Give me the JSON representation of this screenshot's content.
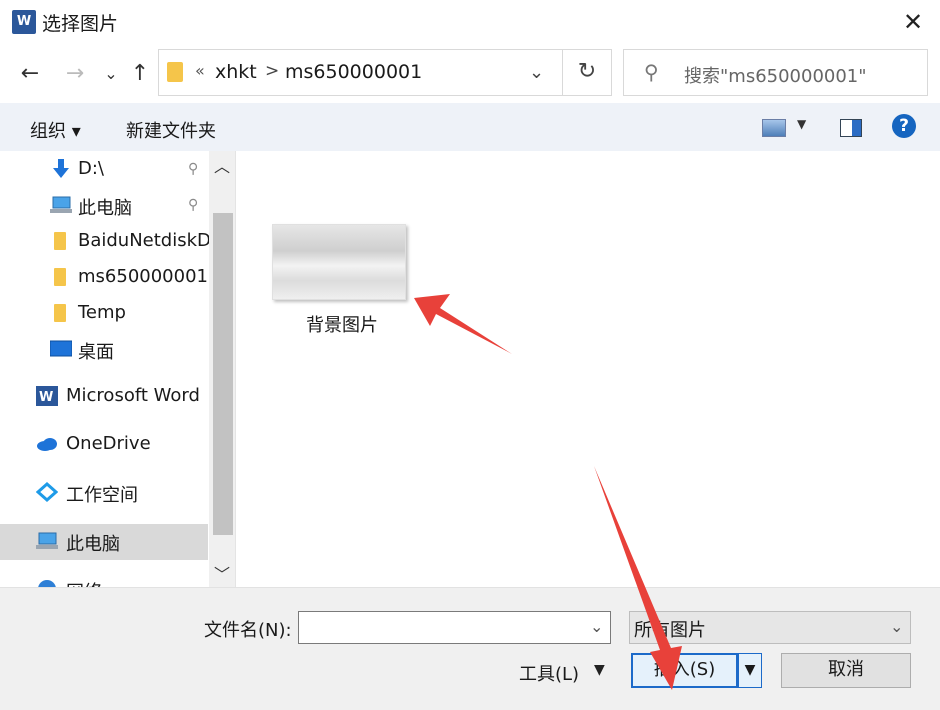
{
  "window": {
    "title": "选择图片",
    "close_glyph": "✕",
    "app_icon_letter": "W"
  },
  "nav": {
    "back": "←",
    "forward": "→",
    "recent": "⌄",
    "up": "↑"
  },
  "address": {
    "overflow": "«",
    "crumbs": [
      "xhkt",
      "ms650000001"
    ],
    "separator": ">",
    "dropdown": "⌄",
    "refresh": "↻"
  },
  "search": {
    "placeholder": "搜索\"ms650000001\"",
    "icon": "⚲"
  },
  "toolbar": {
    "organize": "组织 ▾",
    "new_folder": "新建文件夹",
    "view_dd": "▼",
    "help": "?"
  },
  "navpane": {
    "items": [
      {
        "label": "D:\\",
        "icon": "download-arrow-icon",
        "pinned": true
      },
      {
        "label": "此电脑",
        "icon": "computer-icon",
        "pinned": true
      },
      {
        "label": "BaiduNetdiskD",
        "icon": "folder-icon",
        "pinned": false
      },
      {
        "label": "ms650000001",
        "icon": "folder-icon",
        "pinned": false
      },
      {
        "label": "Temp",
        "icon": "folder-icon",
        "pinned": false
      },
      {
        "label": "桌面",
        "icon": "desktop-icon",
        "pinned": false
      },
      {
        "label": "Microsoft Word",
        "icon": "word-icon",
        "pinned": false
      },
      {
        "label": "OneDrive",
        "icon": "cloud-icon",
        "pinned": false
      },
      {
        "label": "工作空间",
        "icon": "workspace-icon",
        "pinned": false
      },
      {
        "label": "此电脑",
        "icon": "computer-icon",
        "pinned": false,
        "selected": true
      },
      {
        "label": "网络",
        "icon": "network-icon",
        "pinned": false
      }
    ],
    "pin_glyph": "📌",
    "scroll_up": "︿",
    "scroll_down": "﹀"
  },
  "files": [
    {
      "name": "背景图片"
    }
  ],
  "footer": {
    "filename_label": "文件名(N):",
    "filename_value": "",
    "filetype": "所有图片",
    "tools": "工具(L)",
    "insert": "插入(S)",
    "cancel": "取消",
    "dd": "▼"
  },
  "colors": {
    "accent": "#1c6ac9",
    "arrow": "#e8413a",
    "toolbar_bg": "#eef2f8",
    "bottom_bg": "#f0f0f0"
  }
}
